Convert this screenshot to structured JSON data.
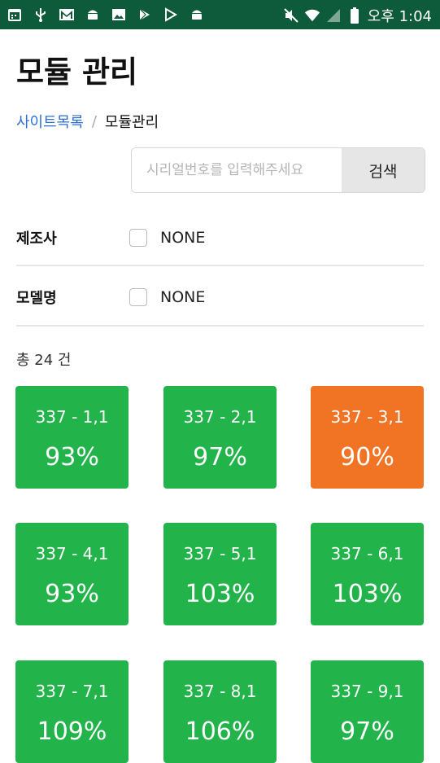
{
  "status_bar": {
    "time": "오후 1:04",
    "left_icons": [
      "calendar-icon",
      "usb-icon",
      "gmail-icon",
      "android-icon",
      "image-icon",
      "play-store-icon",
      "play-icon",
      "android-icon-2"
    ],
    "right_icons": [
      "mute-icon",
      "wifi-icon",
      "signal-icon",
      "battery-icon"
    ],
    "background": "#0d5b3a"
  },
  "page": {
    "title": "모듈 관리",
    "breadcrumb": {
      "parent": "사이트목록",
      "separator": "/",
      "current": "모듈관리"
    }
  },
  "search": {
    "placeholder": "시리얼번호를 입력해주세요",
    "value": "",
    "button_label": "검색"
  },
  "filters": [
    {
      "label": "제조사",
      "option": "NONE",
      "checked": false
    },
    {
      "label": "모델명",
      "option": "NONE",
      "checked": false
    }
  ],
  "result_count": "총 24 건",
  "colors": {
    "normal": "#22b44a",
    "warning": "#f07423",
    "link": "#2d6fd0"
  },
  "modules": [
    {
      "id": "337 - 1,1",
      "percent": "93%",
      "status": "normal"
    },
    {
      "id": "337 - 2,1",
      "percent": "97%",
      "status": "normal"
    },
    {
      "id": "337 - 3,1",
      "percent": "90%",
      "status": "warning"
    },
    {
      "id": "337 - 4,1",
      "percent": "93%",
      "status": "normal"
    },
    {
      "id": "337 - 5,1",
      "percent": "103%",
      "status": "normal"
    },
    {
      "id": "337 - 6,1",
      "percent": "103%",
      "status": "normal"
    },
    {
      "id": "337 - 7,1",
      "percent": "109%",
      "status": "normal"
    },
    {
      "id": "337 - 8,1",
      "percent": "106%",
      "status": "normal"
    },
    {
      "id": "337 - 9,1",
      "percent": "97%",
      "status": "normal"
    }
  ]
}
